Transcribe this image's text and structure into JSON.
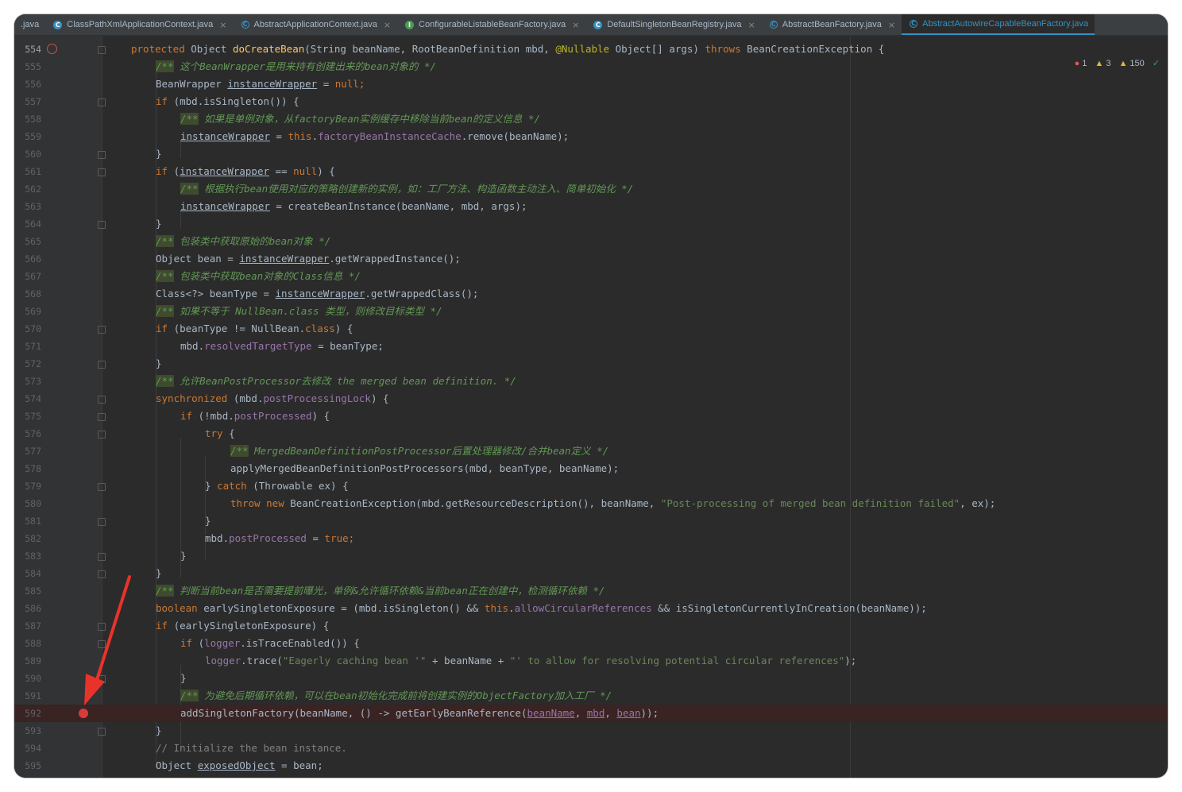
{
  "tabs": [
    {
      "label": ".java",
      "icon": "",
      "active": false
    },
    {
      "label": "ClassPathXmlApplicationContext.java",
      "icon": "C",
      "active": false
    },
    {
      "label": "AbstractApplicationContext.java",
      "icon": "C",
      "active": false
    },
    {
      "label": "ConfigurableListableBeanFactory.java",
      "icon": "I",
      "active": false
    },
    {
      "label": "DefaultSingletonBeanRegistry.java",
      "icon": "C",
      "active": false
    },
    {
      "label": "AbstractBeanFactory.java",
      "icon": "C",
      "active": false
    },
    {
      "label": "AbstractAutowireCapableBeanFactory.java",
      "icon": "C",
      "active": true
    }
  ],
  "status": {
    "errors": "1",
    "warnings_a": "3",
    "warnings_b": "150"
  },
  "lines": {
    "l554": {
      "n": "554",
      "a": "protected",
      "b": " Object ",
      "c": "doCreateBean",
      "d": "(String beanName, RootBeanDefinition mbd, ",
      "e": "@Nullable",
      "f": " Object[] args) ",
      "g": "throws",
      "h": " BeanCreationException {"
    },
    "l555": {
      "n": "555",
      "a": "/**",
      "b": " 这个BeanWrapper是用来持有创建出来的bean对象的 */"
    },
    "l556": {
      "n": "556",
      "a": "BeanWrapper ",
      "b": "instanceWrapper",
      "c": " = ",
      "d": "null",
      "e": ";"
    },
    "l557": {
      "n": "557",
      "a": "if",
      "b": " (mbd.isSingleton()) {"
    },
    "l558": {
      "n": "558",
      "a": "/**",
      "b": " 如果是单例对象，从factoryBean实例缓存中移除当前bean的定义信息 */"
    },
    "l559": {
      "n": "559",
      "a": "instanceWrapper",
      "b": " = ",
      "c": "this",
      "d": ".",
      "e": "factoryBeanInstanceCache",
      "f": ".remove(beanName);"
    },
    "l560": {
      "n": "560",
      "a": "}"
    },
    "l561": {
      "n": "561",
      "a": "if",
      "b": " (",
      "c": "instanceWrapper",
      "d": " == ",
      "e": "null",
      "f": ") {"
    },
    "l562": {
      "n": "562",
      "a": "/**",
      "b": " 根据执行bean使用对应的策略创建新的实例，如：工厂方法、构造函数主动注入、简单初始化 */"
    },
    "l563": {
      "n": "563",
      "a": "instanceWrapper",
      "b": " = createBeanInstance(beanName, mbd, args);"
    },
    "l564": {
      "n": "564",
      "a": "}"
    },
    "l565": {
      "n": "565",
      "a": "/**",
      "b": " 包装类中获取原始的bean对象 */"
    },
    "l566": {
      "n": "566",
      "a": "Object bean = ",
      "b": "instanceWrapper",
      "c": ".getWrappedInstance();"
    },
    "l567": {
      "n": "567",
      "a": "/**",
      "b": " 包装类中获取bean对象的Class信息 */"
    },
    "l568": {
      "n": "568",
      "a": "Class<?> beanType = ",
      "b": "instanceWrapper",
      "c": ".getWrappedClass();"
    },
    "l569": {
      "n": "569",
      "a": "/**",
      "b": " 如果不等于 NullBean.class 类型，则修改目标类型 */"
    },
    "l570": {
      "n": "570",
      "a": "if",
      "b": " (beanType != NullBean.",
      "c": "class",
      "d": ") {"
    },
    "l571": {
      "n": "571",
      "a": "mbd.",
      "b": "resolvedTargetType",
      "c": " = beanType;"
    },
    "l572": {
      "n": "572",
      "a": "}"
    },
    "l573": {
      "n": "573",
      "a": "/**",
      "b": " 允许BeanPostProcessor去修改 the merged bean definition. */"
    },
    "l574": {
      "n": "574",
      "a": "synchronized",
      "b": " (mbd.",
      "c": "postProcessingLock",
      "d": ") {"
    },
    "l575": {
      "n": "575",
      "a": "if",
      "b": " (!mbd.",
      "c": "postProcessed",
      "d": ") {"
    },
    "l576": {
      "n": "576",
      "a": "try",
      "b": " {"
    },
    "l577": {
      "n": "577",
      "a": "/**",
      "b": " MergedBeanDefinitionPostProcessor后置处理器修改/合并bean定义 */"
    },
    "l578": {
      "n": "578",
      "a": "applyMergedBeanDefinitionPostProcessors(mbd, beanType, beanName);"
    },
    "l579": {
      "n": "579",
      "a": "} ",
      "b": "catch",
      "c": " (Throwable ex) {"
    },
    "l580": {
      "n": "580",
      "a": "throw new",
      "b": " BeanCreationException(mbd.getResourceDescription(), beanName, ",
      "c": "\"Post-processing of merged bean definition failed\"",
      "d": ", ex);"
    },
    "l581": {
      "n": "581",
      "a": "}"
    },
    "l582": {
      "n": "582",
      "a": "mbd.",
      "b": "postProcessed",
      "c": " = ",
      "d": "true",
      "e": ";"
    },
    "l583": {
      "n": "583",
      "a": "}"
    },
    "l584": {
      "n": "584",
      "a": "}"
    },
    "l585": {
      "n": "585",
      "a": "/**",
      "b": " 判断当前bean是否需要提前曝光，单例&允许循环依赖&当前bean正在创建中，检测循环依赖 */"
    },
    "l586": {
      "n": "586",
      "a": "boolean",
      "b": " earlySingletonExposure = (mbd.isSingleton() && ",
      "c": "this",
      "d": ".",
      "e": "allowCircularReferences",
      "f": " && isSingletonCurrentlyInCreation(beanName));"
    },
    "l587": {
      "n": "587",
      "a": "if",
      "b": " (earlySingletonExposure) {"
    },
    "l588": {
      "n": "588",
      "a": "if",
      "b": " (",
      "c": "logger",
      "d": ".isTraceEnabled()) {"
    },
    "l589": {
      "n": "589",
      "a": "logger",
      "b": ".trace(",
      "c": "\"Eagerly caching bean '\"",
      "d": " + beanName + ",
      "e": "\"' to allow for resolving potential circular references\"",
      "f": ");"
    },
    "l590": {
      "n": "590",
      "a": "}"
    },
    "l591": {
      "n": "591",
      "a": "/**",
      "b": " 为避免后期循环依赖，可以在bean初始化完成前将创建实例的ObjectFactory加入工厂 */"
    },
    "l592": {
      "n": "592",
      "a": "addSingletonFactory(beanName, () -> getEarlyBeanReference(",
      "b": "beanName",
      "c": ", ",
      "d": "mbd",
      "e": ", ",
      "f": "bean",
      "g": "));"
    },
    "l593": {
      "n": "593",
      "a": "}"
    },
    "l594": {
      "n": "594",
      "a": "// Initialize the bean instance."
    },
    "l595": {
      "n": "595",
      "a": "Object ",
      "b": "exposedObject",
      "c": " = bean;"
    }
  },
  "colors": {
    "keyword": "#cc7832",
    "method": "#ffc66d",
    "string": "#6a8759",
    "field": "#9876aa",
    "comment": "#629755",
    "breakpoint": "#d83b3b",
    "annotation_arrow": "#e8332a"
  }
}
